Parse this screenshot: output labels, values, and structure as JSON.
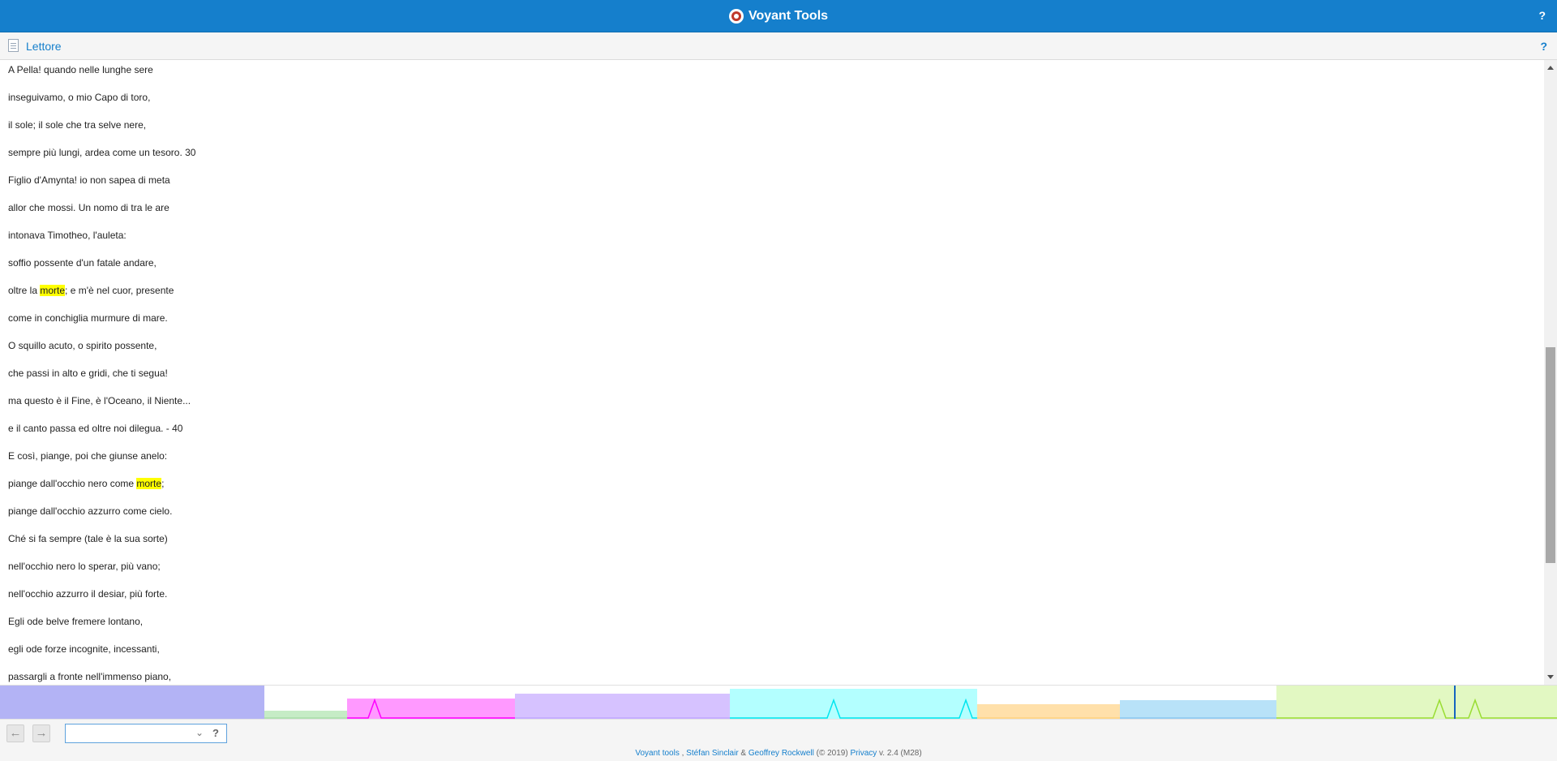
{
  "app": {
    "title": "Voyant Tools",
    "help": "?"
  },
  "panel": {
    "title": "Lettore",
    "help": "?"
  },
  "reader": {
    "lines": [
      {
        "parts": [
          {
            "t": "A Pella! quando nelle lunghe sere"
          }
        ]
      },
      {
        "parts": [
          {
            "t": "inseguivamo, o mio Capo di toro,"
          }
        ]
      },
      {
        "parts": [
          {
            "t": "il sole; il sole che tra selve nere,"
          }
        ]
      },
      {
        "parts": [
          {
            "t": "sempre più lungi, ardea come un tesoro. 30"
          }
        ]
      },
      {
        "parts": [
          {
            "t": "Figlio d'Amynta! io non sapea di meta"
          }
        ]
      },
      {
        "parts": [
          {
            "t": "allor che mossi. Un nomo di tra le are"
          }
        ]
      },
      {
        "parts": [
          {
            "t": "intonava Timotheo, l'auleta:"
          }
        ]
      },
      {
        "parts": [
          {
            "t": "soffio possente d'un fatale andare,"
          }
        ]
      },
      {
        "parts": [
          {
            "t": "oltre la "
          },
          {
            "t": "morte",
            "hl": true
          },
          {
            "t": "; e m'è nel cuor, presente"
          }
        ]
      },
      {
        "parts": [
          {
            "t": "come in conchiglia murmure di mare."
          }
        ]
      },
      {
        "parts": [
          {
            "t": "O squillo acuto, o spirito possente,"
          }
        ]
      },
      {
        "parts": [
          {
            "t": "che passi in alto e gridi, che ti segua!"
          }
        ]
      },
      {
        "parts": [
          {
            "t": "ma questo è il Fine, è l'Oceano, il Niente..."
          }
        ]
      },
      {
        "parts": [
          {
            "t": "e il canto passa ed oltre noi dilegua. - 40"
          }
        ]
      },
      {
        "parts": [
          {
            "t": "E così, piange, poi che giunse anelo:"
          }
        ]
      },
      {
        "parts": [
          {
            "t": "piange dall'occhio nero come "
          },
          {
            "t": "morte",
            "hl": true
          },
          {
            "t": ";"
          }
        ]
      },
      {
        "parts": [
          {
            "t": "piange dall'occhio azzurro come cielo."
          }
        ]
      },
      {
        "parts": [
          {
            "t": "Ché si fa sempre (tale è la sua sorte)"
          }
        ]
      },
      {
        "parts": [
          {
            "t": "nell'occhio nero lo sperar, più vano;"
          }
        ]
      },
      {
        "parts": [
          {
            "t": "nell'occhio azzurro il desiar, più forte."
          }
        ]
      },
      {
        "parts": [
          {
            "t": "Egli ode belve fremere lontano,"
          }
        ]
      },
      {
        "parts": [
          {
            "t": "egli ode forze incognite, incessanti,"
          }
        ]
      },
      {
        "parts": [
          {
            "t": "passargli a fronte nell'immenso piano,"
          }
        ]
      }
    ]
  },
  "strip": {
    "colors": [
      "#b3b3f5",
      "#c6ecc6",
      "#ff99ff",
      "#d6c2ff",
      "#b3ffff",
      "#ffe0aa",
      "#b8e2f8",
      "#e2f8c2"
    ],
    "line_colors": [
      "#b3b3f5",
      "#aaddaa",
      "#ff00ff",
      "#c0a8ff",
      "#00e5ee",
      "#ffd280",
      "#8cc8f0",
      "#99dd33"
    ],
    "fill_level": [
      1.0,
      0.25,
      0.6,
      0.75,
      0.9,
      0.45,
      0.55,
      1.0
    ],
    "cursor_color": "#1565c0"
  },
  "toolbar": {
    "back_icon": "arrow-left-icon",
    "forward_icon": "arrow-right-icon",
    "back_glyph": "←",
    "forward_glyph": "→",
    "search_value": "",
    "search_placeholder": "",
    "dropdown_glyph": "⌄",
    "help": "?"
  },
  "footer": {
    "tool": "Voyant tools",
    "sep1": " , ",
    "author1": "Stéfan Sinclair",
    "amp": " & ",
    "author2": "Geoffrey Rockwell",
    "copyright": " (© 2019) ",
    "privacy": "Privacy",
    "version": " v. 2.4 (M28)"
  }
}
